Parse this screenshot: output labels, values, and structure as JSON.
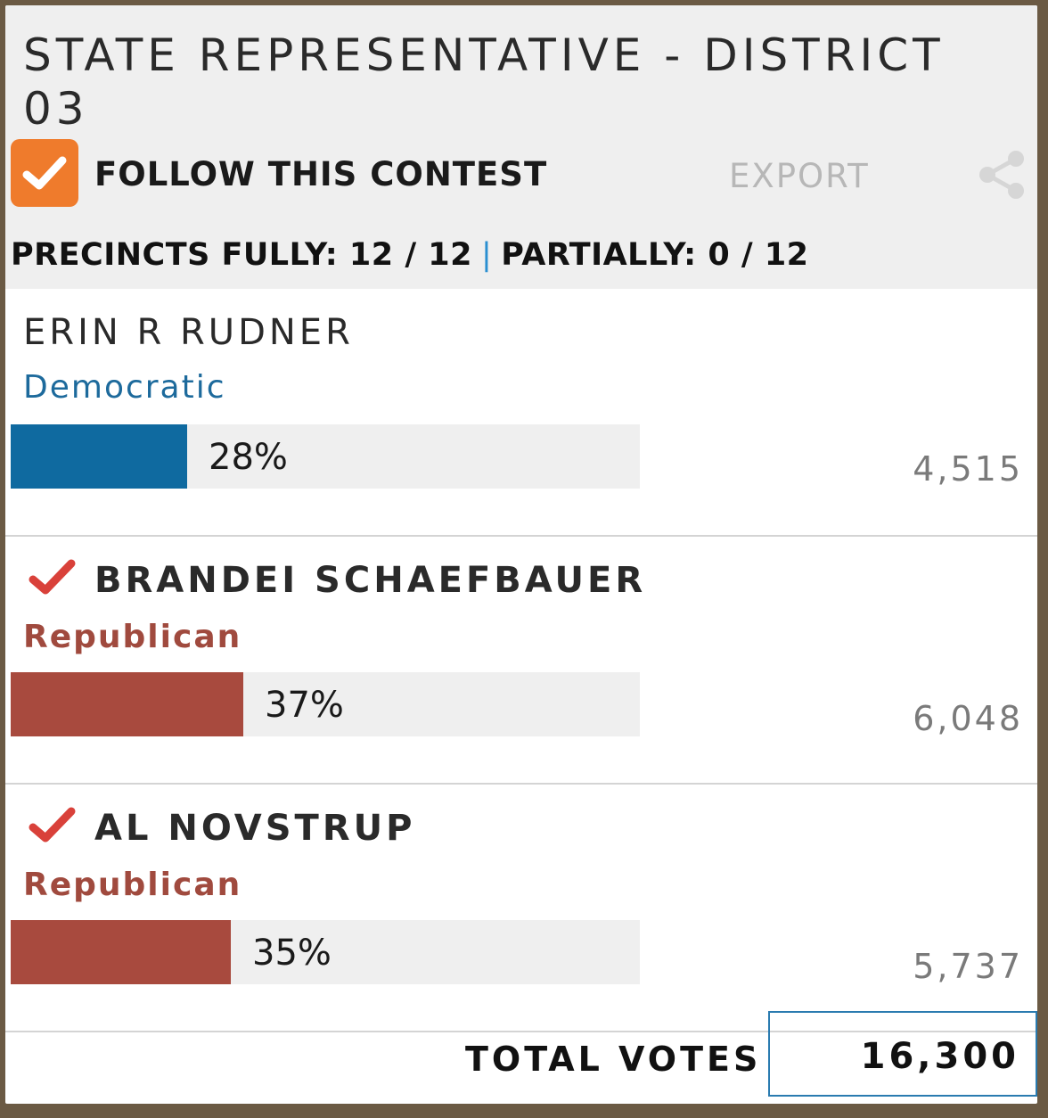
{
  "contest": {
    "title": "STATE REPRESENTATIVE - DISTRICT 03",
    "follow_label": "FOLLOW THIS CONTEST",
    "follow_checked": true,
    "export_label": "EXPORT",
    "share_icon": "share-icon",
    "precincts_fully_label": "PRECINCTS FULLY: 12 / 12",
    "precincts_separator": "|",
    "precincts_partially_label": "PARTIALLY: 0 / 12"
  },
  "candidates": [
    {
      "name": "ERIN R RUDNER",
      "party": "Democratic",
      "percent_label": "28%",
      "share": 28,
      "votes": "4,515",
      "winner": false,
      "color": "#0f6aa0"
    },
    {
      "name": "BRANDEI SCHAEFBAUER",
      "party": "Republican",
      "percent_label": "37%",
      "share": 37,
      "votes": "6,048",
      "winner": true,
      "color": "#a84a3e"
    },
    {
      "name": "AL NOVSTRUP",
      "party": "Republican",
      "percent_label": "35%",
      "share": 35,
      "votes": "5,737",
      "winner": true,
      "color": "#a84a3e"
    }
  ],
  "totals": {
    "label": "TOTAL VOTES",
    "value": "16,300"
  },
  "colors": {
    "follow_accent": "#ef7b2c",
    "separator": "#2a8fd1",
    "winner_check": "#d9413a"
  }
}
